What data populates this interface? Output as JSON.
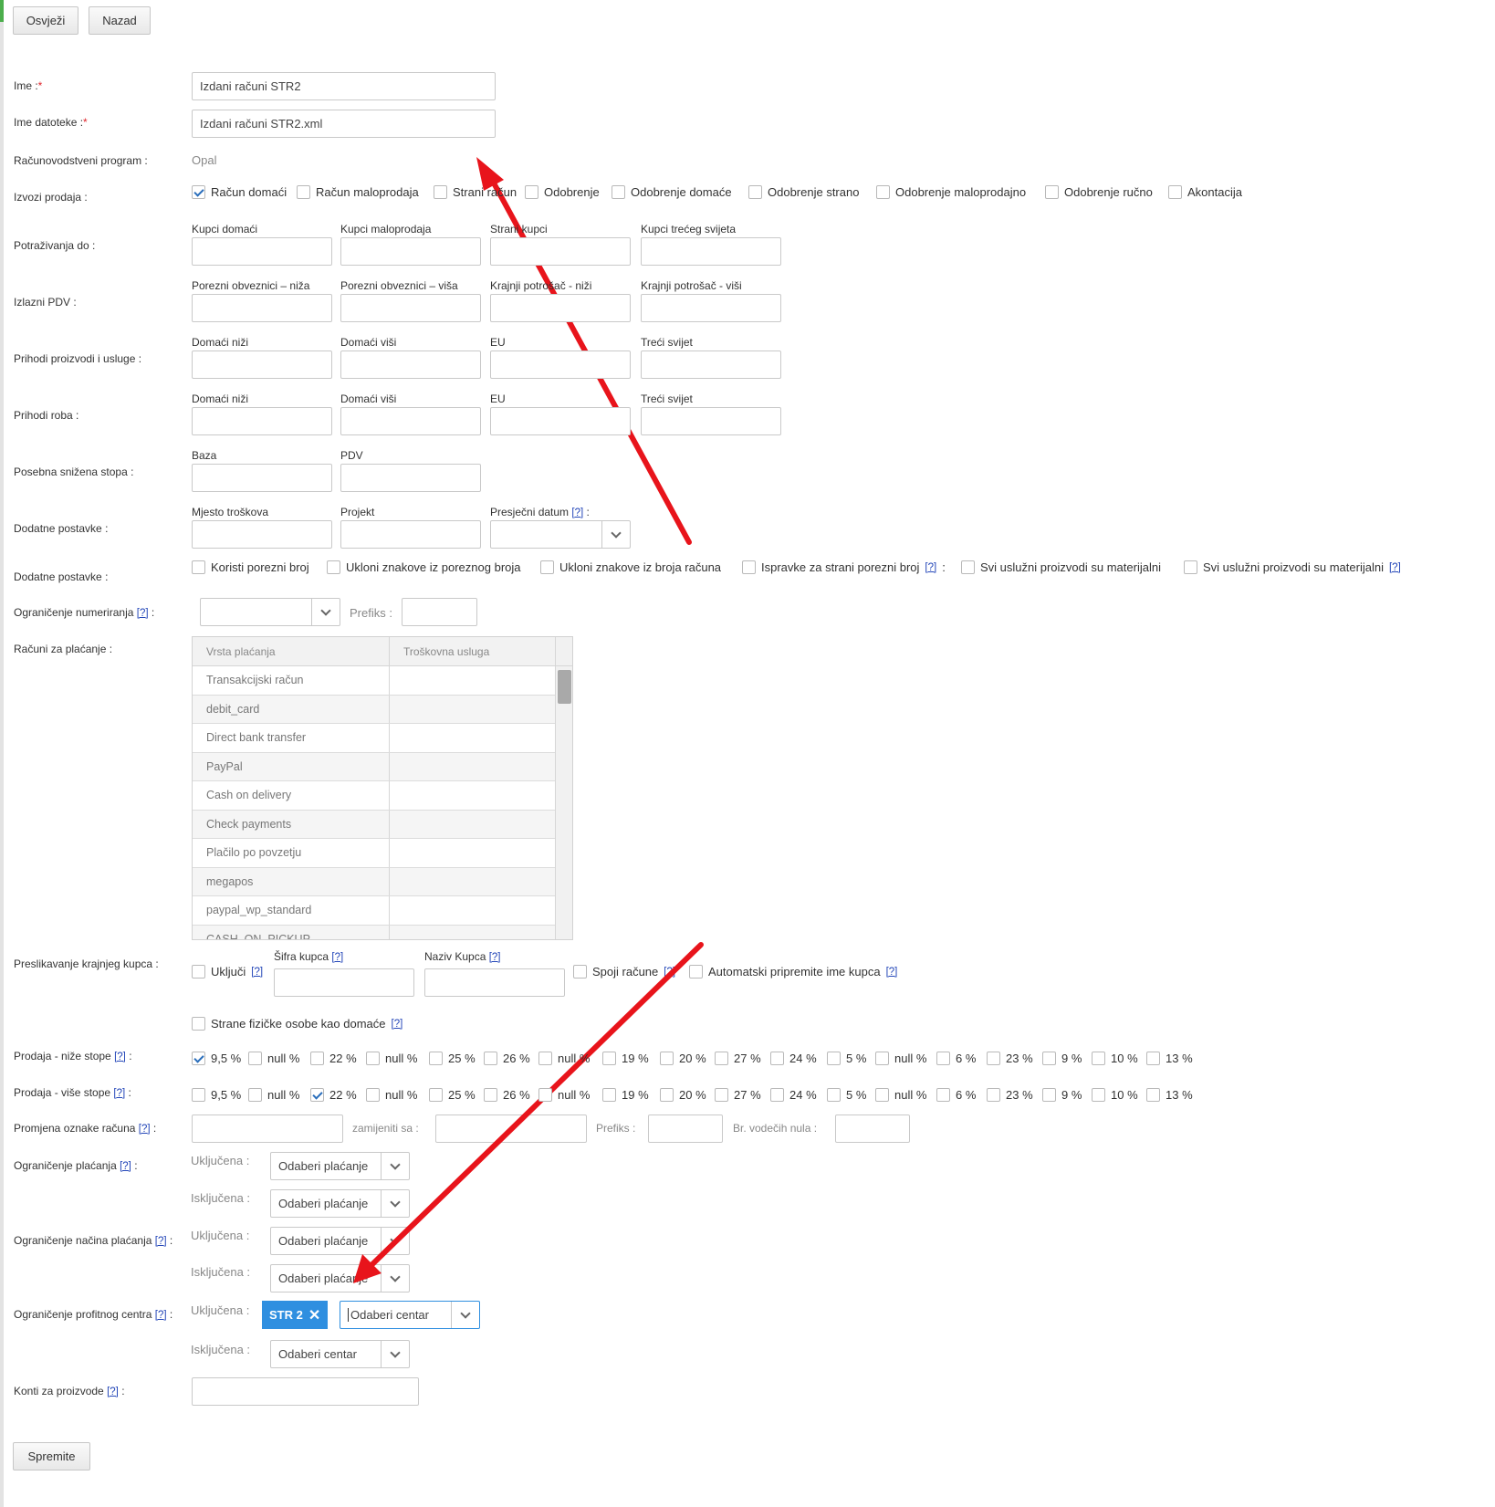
{
  "toolbar": {
    "refresh_label": "Osvježi",
    "back_label": "Nazad"
  },
  "fields": {
    "name": {
      "label": "Ime :",
      "required": "*",
      "value": "Izdani računi STR2"
    },
    "filename": {
      "label": "Ime datoteke :",
      "required": "*",
      "value": "Izdani računi STR2.xml"
    },
    "program": {
      "label": "Računovodstveni program :",
      "value": "Opal"
    }
  },
  "exports": {
    "label": "Izvozi prodaja :",
    "items": [
      {
        "label": "Račun domaći",
        "checked": true
      },
      {
        "label": "Račun maloprodaja",
        "checked": false
      },
      {
        "label": "Strani račun",
        "checked": false
      },
      {
        "label": "Odobrenje",
        "checked": false
      },
      {
        "label": "Odobrenje domaće",
        "checked": false
      },
      {
        "label": "Odobrenje strano",
        "checked": false
      },
      {
        "label": "Odobrenje maloprodajno",
        "checked": false
      },
      {
        "label": "Odobrenje ručno",
        "checked": false
      },
      {
        "label": "Akontacija",
        "checked": false
      }
    ]
  },
  "grids": [
    {
      "label": "Potraživanja do :",
      "cols": [
        "Kupci domaći",
        "Kupci maloprodaja",
        "Strani kupci",
        "Kupci trećeg svijeta"
      ]
    },
    {
      "label": "Izlazni PDV :",
      "cols": [
        "Porezni obveznici – niža",
        "Porezni obveznici – viša",
        "Krajnji potrošač - niži",
        "Krajnji potrošač - viši"
      ]
    },
    {
      "label": "Prihodi proizvodi i usluge :",
      "cols": [
        "Domaći niži",
        "Domaći viši",
        "EU",
        "Treći svijet"
      ]
    },
    {
      "label": "Prihodi roba :",
      "cols": [
        "Domaći niži",
        "Domaći viši",
        "EU",
        "Treći svijet"
      ]
    },
    {
      "label": "Posebna snižena stopa :",
      "cols": [
        "Baza",
        "PDV"
      ]
    },
    {
      "label": "Dodatne postavke :",
      "cols": [
        "Mjesto troškova",
        "Projekt"
      ],
      "date_label": "Presječni datum",
      "date_suffix": ":"
    }
  ],
  "help": "[?]",
  "additional": {
    "label": "Dodatne postavke :",
    "items": [
      {
        "label": "Koristi porezni broj"
      },
      {
        "label": "Ukloni znakove iz poreznog broja"
      },
      {
        "label": "Ukloni znakove iz broja računa"
      },
      {
        "label": "Ispravke za strani porezni broj",
        "suffix": ":"
      },
      {
        "label": "Svi uslužni proizvodi su materijalni"
      },
      {
        "label": "Svi uslužni proizvodi su materijalni"
      }
    ]
  },
  "numbering": {
    "label": "Ograničenje numeriranja",
    "prefix_label": "Prefiks :"
  },
  "payments": {
    "label": "Računi za plaćanje :",
    "headers": [
      "Vrsta plaćanja",
      "Troškovna usluga"
    ],
    "rows": [
      "Transakcijski račun",
      "debit_card",
      "Direct bank transfer",
      "PayPal",
      "Cash on delivery",
      "Check payments",
      "Plačilo po povzetju",
      "megapos",
      "paypal_wp_standard",
      "CASH_ON_PICKUP"
    ]
  },
  "buyer_map": {
    "label": "Preslikavanje krajnjeg kupca :",
    "include": "Uključi",
    "code_label": "Šifra kupca",
    "name_label": "Naziv Kupca",
    "merge": "Spoji račune",
    "auto": "Automatski pripremite ime kupca",
    "foreign": "Strane fizičke osobe kao domaće"
  },
  "rates_low": {
    "label": "Prodaja - niže stope",
    "items": [
      {
        "l": "9,5 %",
        "c": true
      },
      {
        "l": "null %",
        "c": false
      },
      {
        "l": "22 %",
        "c": false
      },
      {
        "l": "null %",
        "c": false
      },
      {
        "l": "25 %",
        "c": false
      },
      {
        "l": "26 %",
        "c": false
      },
      {
        "l": "null %",
        "c": false
      },
      {
        "l": "19 %",
        "c": false
      },
      {
        "l": "20 %",
        "c": false
      },
      {
        "l": "27 %",
        "c": false
      },
      {
        "l": "24 %",
        "c": false
      },
      {
        "l": "5 %",
        "c": false
      },
      {
        "l": "null %",
        "c": false
      },
      {
        "l": "6 %",
        "c": false
      },
      {
        "l": "23 %",
        "c": false
      },
      {
        "l": "9 %",
        "c": false
      },
      {
        "l": "10 %",
        "c": false
      },
      {
        "l": "13 %",
        "c": false
      }
    ]
  },
  "rates_high": {
    "label": "Prodaja - više stope",
    "items": [
      {
        "l": "9,5 %",
        "c": false
      },
      {
        "l": "null %",
        "c": false
      },
      {
        "l": "22 %",
        "c": true
      },
      {
        "l": "null %",
        "c": false
      },
      {
        "l": "25 %",
        "c": false
      },
      {
        "l": "26 %",
        "c": false
      },
      {
        "l": "null %",
        "c": false
      },
      {
        "l": "19 %",
        "c": false
      },
      {
        "l": "20 %",
        "c": false
      },
      {
        "l": "27 %",
        "c": false
      },
      {
        "l": "24 %",
        "c": false
      },
      {
        "l": "5 %",
        "c": false
      },
      {
        "l": "null %",
        "c": false
      },
      {
        "l": "6 %",
        "c": false
      },
      {
        "l": "23 %",
        "c": false
      },
      {
        "l": "9 %",
        "c": false
      },
      {
        "l": "10 %",
        "c": false
      },
      {
        "l": "13 %",
        "c": false
      }
    ]
  },
  "relabel": {
    "label": "Promjena oznake računa",
    "replace": "zamijeniti sa :",
    "prefix": "Prefiks :",
    "zeros": "Br. vodečih nula :"
  },
  "pay_limit": {
    "label": "Ograničenje plaćanja",
    "included": "Uključena :",
    "excluded": "Isključena :",
    "placeholder": "Odaberi plaćanje"
  },
  "pay_method_limit": {
    "label": "Ograničenje načina plaćanja",
    "included": "Uključena :",
    "excluded": "Isključena :",
    "placeholder": "Odaberi plaćanje"
  },
  "profit_center": {
    "label": "Ograničenje profitnog centra",
    "included": "Uključena :",
    "excluded": "Isključena :",
    "tag": "STR 2",
    "placeholder": "Odaberi centar"
  },
  "accounts": {
    "label": "Konti za proizvode"
  },
  "save_label": "Spremite",
  "colors": {
    "arrow": "#e8141b",
    "tag": "#2f8fe0",
    "check": "#2a6ebb"
  }
}
